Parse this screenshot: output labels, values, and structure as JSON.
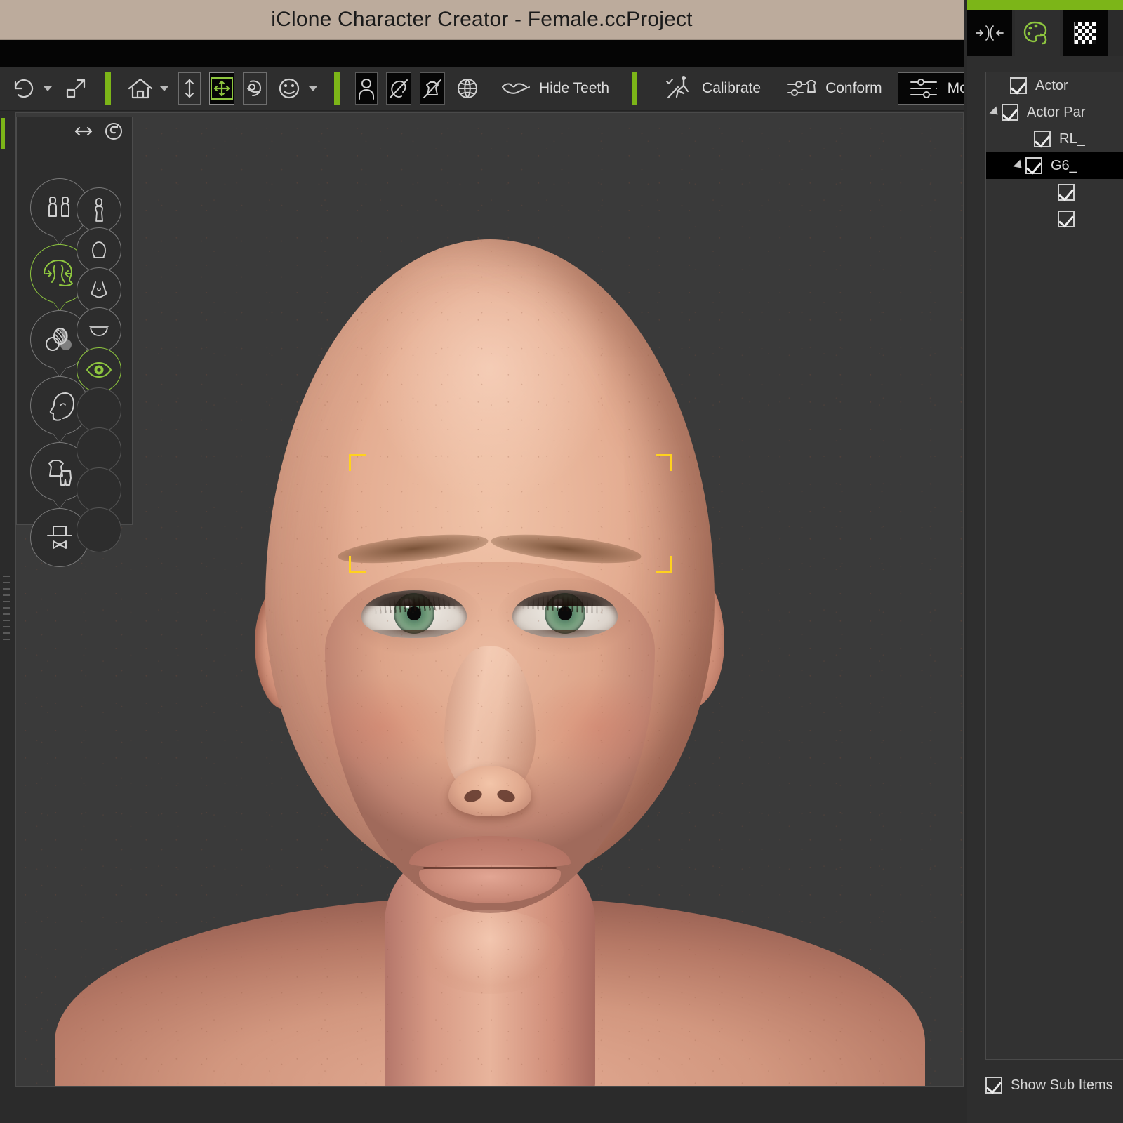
{
  "window": {
    "title": "iClone Character Creator - Female.ccProject"
  },
  "colors": {
    "titlebar_bg": "#bcab9c",
    "accent_green": "#7cb518",
    "panel_bg": "#2e2e2e",
    "viewport_bg": "#3a3a3a",
    "selection_yellow": "#ffd21e",
    "text": "#d8d8d8"
  },
  "toolbar": {
    "groups": [
      {
        "items": [
          {
            "name": "undo-icon",
            "label": "",
            "icon": "undo-icon",
            "has_caret": true,
            "state": "normal"
          },
          {
            "name": "expand-icon",
            "label": "",
            "icon": "expand-icon",
            "has_caret": false,
            "state": "normal"
          }
        ]
      },
      {
        "items": [
          {
            "name": "home-icon",
            "label": "",
            "icon": "home-icon",
            "has_caret": true,
            "state": "normal"
          },
          {
            "name": "height-icon",
            "label": "",
            "icon": "height-icon",
            "has_caret": false,
            "state": "boxed"
          },
          {
            "name": "move-icon",
            "label": "",
            "icon": "move-icon",
            "has_caret": false,
            "state": "selected"
          },
          {
            "name": "rotate-object-icon",
            "label": "",
            "icon": "rotate-object-icon",
            "has_caret": false,
            "state": "boxed"
          },
          {
            "name": "expression-icon",
            "label": "",
            "icon": "smiley-icon",
            "has_caret": true,
            "state": "normal"
          }
        ]
      },
      {
        "items": [
          {
            "name": "body-icon",
            "label": "",
            "icon": "person-icon",
            "has_caret": false,
            "state": "dark"
          },
          {
            "name": "hide-hair-icon",
            "label": "",
            "icon": "no-hair-icon",
            "has_caret": false,
            "state": "dark"
          },
          {
            "name": "hide-cloth-icon",
            "label": "",
            "icon": "no-cloth-icon",
            "has_caret": false,
            "state": "dark"
          },
          {
            "name": "globe-icon",
            "label": "",
            "icon": "globe-icon",
            "has_caret": false,
            "state": "normal"
          },
          {
            "name": "hide-teeth-button",
            "label": "Hide Teeth",
            "icon": "lips-icon",
            "has_caret": false,
            "state": "normal"
          }
        ]
      },
      {
        "items": [
          {
            "name": "calibrate-button",
            "label": "Calibrate",
            "icon": "calibrate-icon",
            "has_caret": false,
            "state": "normal"
          },
          {
            "name": "conform-button",
            "label": "Conform",
            "icon": "conform-icon",
            "has_caret": false,
            "state": "normal"
          },
          {
            "name": "modify-button",
            "label": "Modify",
            "icon": "sliders-icon",
            "has_caret": false,
            "state": "boxed-text"
          }
        ]
      }
    ]
  },
  "right_tabs": [
    {
      "name": "tab-fit",
      "icon": "fit-icon",
      "active": false
    },
    {
      "name": "tab-material",
      "icon": "palette-icon",
      "active": true
    },
    {
      "name": "tab-texture",
      "icon": "checker-icon",
      "active": false
    }
  ],
  "palette": {
    "header": {
      "flip_icon": "flip-horizontal-icon",
      "reset_icon": "reset-icon"
    },
    "left_column": [
      {
        "name": "node-avatar",
        "icon": "two-people-icon",
        "active": false,
        "bubble": true
      },
      {
        "name": "node-head-shape",
        "icon": "face-arrows-icon",
        "active": true,
        "bubble": true
      },
      {
        "name": "node-skin",
        "icon": "skin-swatch-icon",
        "active": false,
        "bubble": true
      },
      {
        "name": "node-profile",
        "icon": "head-profile-icon",
        "active": false,
        "bubble": true
      },
      {
        "name": "node-cloth",
        "icon": "shirt-pants-icon",
        "active": false,
        "bubble": true
      },
      {
        "name": "node-accessory",
        "icon": "hat-bowtie-icon",
        "active": false,
        "bubble": false
      }
    ],
    "right_column": [
      {
        "name": "node-body",
        "icon": "body-icon",
        "active": false
      },
      {
        "name": "node-head",
        "icon": "head-icon",
        "active": false
      },
      {
        "name": "node-nose",
        "icon": "nose-icon",
        "active": false
      },
      {
        "name": "node-mouth",
        "icon": "mouth-icon",
        "active": false
      },
      {
        "name": "node-eye",
        "icon": "eye-icon",
        "active": true
      },
      {
        "name": "node-empty-1",
        "icon": "",
        "active": false
      },
      {
        "name": "node-empty-2",
        "icon": "",
        "active": false
      },
      {
        "name": "node-empty-3",
        "icon": "",
        "active": false
      },
      {
        "name": "node-empty-4",
        "icon": "",
        "active": false
      }
    ]
  },
  "scene_tree": {
    "rows": [
      {
        "label": "Actor",
        "indent": 0,
        "checked": true,
        "expandable": false,
        "selected": false
      },
      {
        "label": "Actor Par",
        "indent": 0,
        "checked": true,
        "expandable": true,
        "selected": false
      },
      {
        "label": "RL_",
        "indent": 1,
        "checked": true,
        "expandable": false,
        "selected": false
      },
      {
        "label": "G6_",
        "indent": 1,
        "checked": true,
        "expandable": true,
        "selected": true
      },
      {
        "label": "",
        "indent": 2,
        "checked": true,
        "expandable": false,
        "selected": false
      },
      {
        "label": "",
        "indent": 2,
        "checked": true,
        "expandable": false,
        "selected": false
      }
    ],
    "footer": {
      "label": "Show Sub Items",
      "checked": true
    }
  },
  "viewport": {
    "selection_brackets": "eye-region-selection",
    "subject": "female-bald-head-3d-render"
  }
}
